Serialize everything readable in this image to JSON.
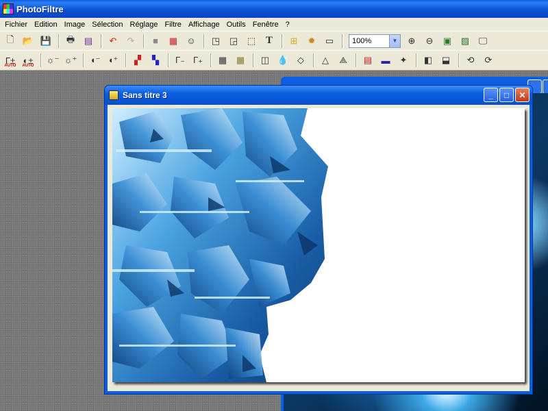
{
  "app": {
    "title": "PhotoFiltre"
  },
  "menu": [
    "Fichier",
    "Edition",
    "Image",
    "Sélection",
    "Réglage",
    "Filtre",
    "Affichage",
    "Outils",
    "Fenêtre",
    "?"
  ],
  "toolbar": {
    "zoom_value": "100%"
  },
  "toolbar2": {
    "auto_label_1": "AUTO",
    "auto_label_2": "AUTO"
  },
  "document": {
    "title": "Sans titre 3"
  },
  "colors": {
    "accent": "#0a5fe0",
    "canvas_bg": "#ffffff",
    "art_primary": "#1f6fb4"
  }
}
